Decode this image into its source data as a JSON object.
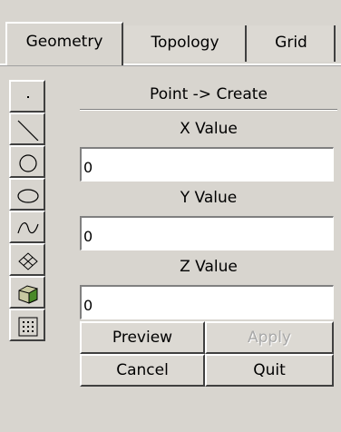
{
  "tabs": [
    {
      "label": "Geometry"
    },
    {
      "label": "Topology"
    },
    {
      "label": "Grid"
    }
  ],
  "toolbar": {
    "items": [
      {
        "icon": "point-icon"
      },
      {
        "icon": "line-icon"
      },
      {
        "icon": "circle-icon"
      },
      {
        "icon": "ellipse-icon"
      },
      {
        "icon": "curve-icon"
      },
      {
        "icon": "surface-icon"
      },
      {
        "icon": "solid-icon"
      },
      {
        "icon": "grid-points-icon"
      }
    ]
  },
  "panel": {
    "header": "Point -> Create",
    "x_label": "X Value",
    "x_value": "0",
    "y_label": "Y Value",
    "y_value": "0",
    "z_label": "Z Value",
    "z_value": "0",
    "buttons": {
      "preview": "Preview",
      "apply": "Apply",
      "cancel": "Cancel",
      "quit": "Quit"
    }
  }
}
